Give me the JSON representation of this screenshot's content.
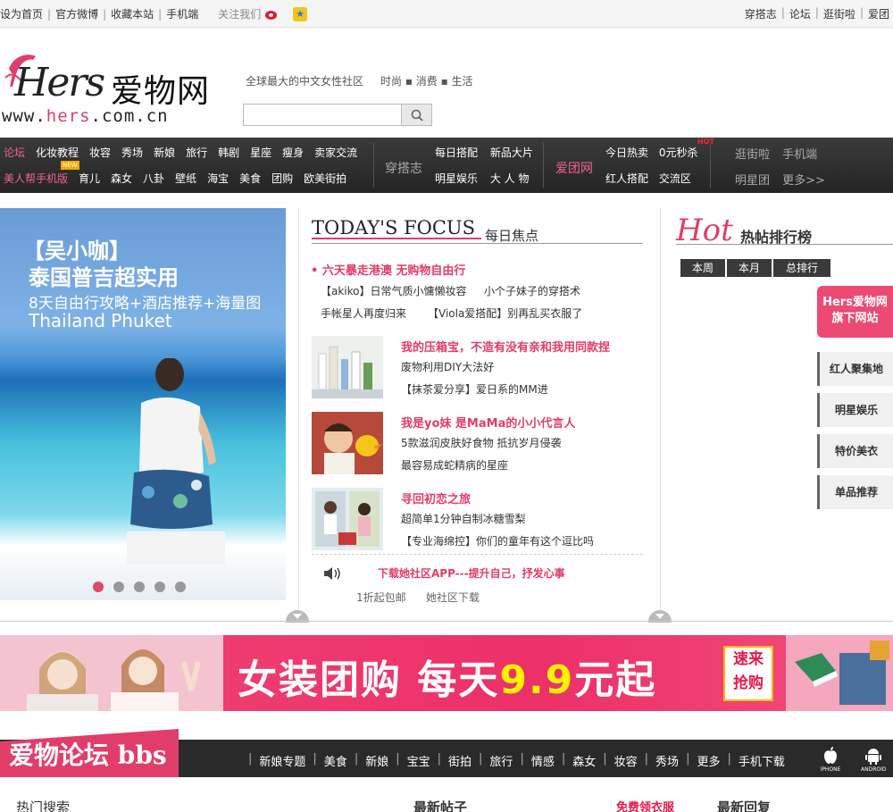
{
  "topbar": {
    "left_links": [
      "设为首页",
      "官方微博",
      "收藏本站",
      "手机端"
    ],
    "follow_label": "关注我们",
    "right_links": [
      "穿搭志",
      "论坛",
      "逛街啦",
      "爱团"
    ]
  },
  "header": {
    "logo_text": "Hers",
    "logo_cn": "爱物网",
    "logo_url_prefix": "www.",
    "logo_url_mid": "hers",
    "logo_url_suffix": ".com.cn",
    "slogan": "全球最大的中文女性社区",
    "tagline": "时尚 ▪ 消费 ▪ 生活",
    "search_placeholder": ""
  },
  "nav": {
    "row1": [
      "论坛",
      "化妆教程",
      "妆容",
      "秀场",
      "新娘",
      "旅行",
      "韩剧",
      "星座",
      "瘦身",
      "卖家交流"
    ],
    "row2": [
      "美人帮手机版",
      "育儿",
      "森女",
      "八卦",
      "壁纸",
      "海宝",
      "美食",
      "团购",
      "欧美街拍"
    ],
    "new_badge": "NEW",
    "group1_title": "穿搭志",
    "group1_r1": [
      "每日搭配",
      "新品大片"
    ],
    "group1_r2": [
      "明星娱乐",
      "大 人 物"
    ],
    "group2_title": "爱团网",
    "group2_r1": [
      "今日热卖",
      "0元秒杀"
    ],
    "group2_r2": [
      "红人搭配",
      "交流区"
    ],
    "hot_badge": "HOT",
    "group3_r1": [
      "逛街啦",
      "手机端"
    ],
    "group3_r2": [
      "明星团",
      "更多>>"
    ]
  },
  "banner": {
    "line1": "【吴小咖】",
    "line2": "泰国普吉超实用",
    "line3": "8天自由行攻略+酒店推荐+海量图",
    "line4": "Thailand Phuket",
    "slides": 5,
    "active_slide": 1
  },
  "focus": {
    "title_en": "TODAY'S FOCUS",
    "title_zh": "每日焦点",
    "headline": "• 六天暴走港澳 无购物自由行",
    "links": [
      [
        "【akiko】日常气质小慵懒妆容",
        "小个子妹子的穿搭术"
      ],
      [
        "手帐星人再度归来",
        "【Viola爱搭配】别再乱买衣服了"
      ]
    ],
    "features": [
      {
        "title": "我的压箱宝，不造有没有亲和我用同款捏",
        "lines": [
          "废物利用DIY大法好",
          "【抹茶爱分享】爱日系的MM进"
        ]
      },
      {
        "title": "我是yo妹 是MaMa的小小代言人",
        "lines": [
          "5款滋润皮肤好食物 抵抗岁月侵袭",
          "最容易成蛇精病的星座"
        ]
      },
      {
        "title": "寻回初恋之旅",
        "lines": [
          "超简单1分钟自制冰糖雪梨",
          "【专业海绵控】你们的童年有这个逗比吗"
        ]
      }
    ],
    "app_text": "下载她社区APP---提升自己，抒发心事",
    "app_links": [
      "1折起包邮",
      "她社区下载"
    ]
  },
  "hot": {
    "title_en": "Hot",
    "title_zh": "热帖排行榜",
    "tabs": [
      "本周",
      "本月",
      "总排行"
    ],
    "badge_line1": "Hers爱物网",
    "badge_line2": "旗下网站",
    "sites": [
      "红人聚集地",
      "明星娱乐",
      "特价美衣",
      "单品推荐"
    ]
  },
  "promo": {
    "text_pre": "女装团购 每天",
    "text_num": "9.9",
    "text_post": "元起",
    "cta1": "速来",
    "cta2": "抢购"
  },
  "bbs": {
    "title": "爱物论坛 bbs",
    "links": [
      "新娘专题",
      "美食",
      "新娘",
      "宝宝",
      "街拍",
      "旅行",
      "情感",
      "森女",
      "妆容",
      "秀场",
      "更多",
      "手机下载"
    ],
    "ios": "IPHONE",
    "android": "ANDROID"
  },
  "bottom": [
    "热门搜索",
    "最新帖子",
    "免费领衣服",
    "最新回复"
  ]
}
